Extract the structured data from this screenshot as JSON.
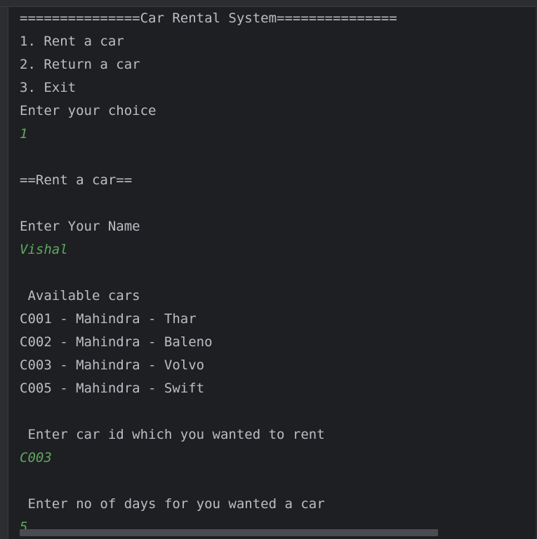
{
  "console": {
    "lines": [
      {
        "text": "===============Car Rental System===============",
        "type": "output"
      },
      {
        "text": "1. Rent a car",
        "type": "output"
      },
      {
        "text": "2. Return a car",
        "type": "output"
      },
      {
        "text": "3. Exit",
        "type": "output"
      },
      {
        "text": "Enter your choice",
        "type": "output"
      },
      {
        "text": "1",
        "type": "input"
      },
      {
        "text": "",
        "type": "output"
      },
      {
        "text": "==Rent a car==",
        "type": "output"
      },
      {
        "text": "",
        "type": "output"
      },
      {
        "text": "Enter Your Name",
        "type": "output"
      },
      {
        "text": "Vishal",
        "type": "input"
      },
      {
        "text": "",
        "type": "output"
      },
      {
        "text": " Available cars",
        "type": "output"
      },
      {
        "text": "C001 - Mahindra - Thar",
        "type": "output"
      },
      {
        "text": "C002 - Mahindra - Baleno",
        "type": "output"
      },
      {
        "text": "C003 - Mahindra - Volvo",
        "type": "output"
      },
      {
        "text": "C005 - Mahindra - Swift",
        "type": "output"
      },
      {
        "text": "",
        "type": "output"
      },
      {
        "text": " Enter car id which you wanted to rent",
        "type": "output"
      },
      {
        "text": "C003",
        "type": "input"
      },
      {
        "text": "",
        "type": "output"
      },
      {
        "text": " Enter no of days for you wanted a car",
        "type": "output"
      },
      {
        "text": "5",
        "type": "input"
      }
    ]
  },
  "colors": {
    "background": "#1e1f22",
    "output_text": "#bcbec4",
    "user_input_text": "#5fa85f"
  }
}
